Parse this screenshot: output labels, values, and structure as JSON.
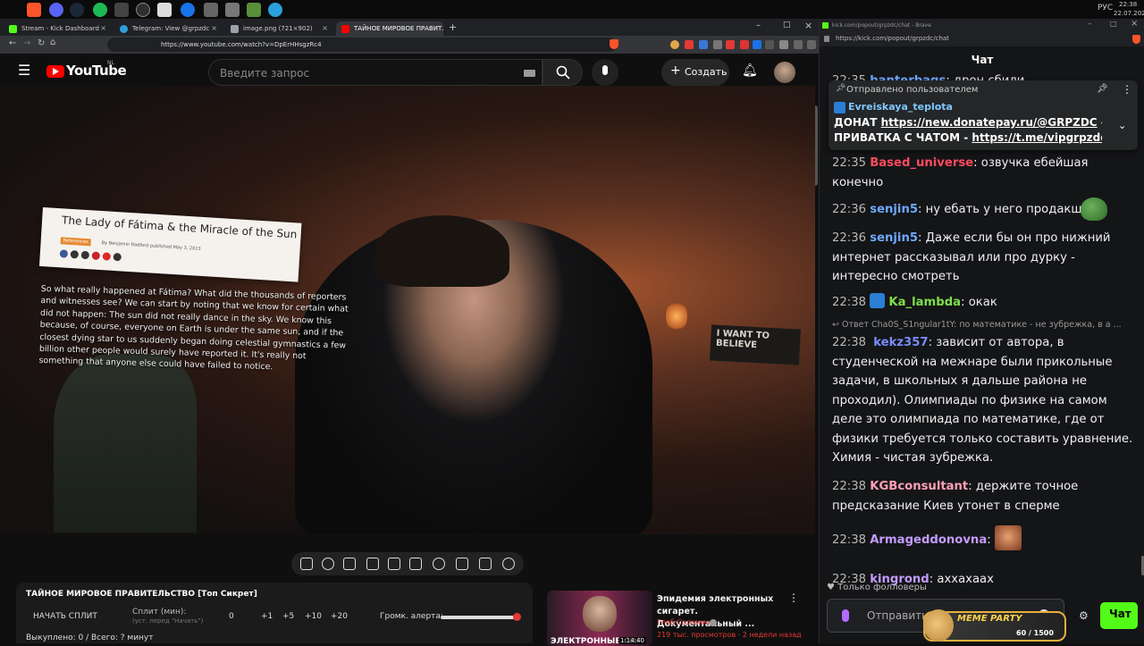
{
  "taskbar": {
    "clock_time": "22:38",
    "clock_date": "22.07.2025",
    "lang": "РУС"
  },
  "left_browser": {
    "tabs": [
      {
        "label": "Stream - Kick Dashboard",
        "color": "#53fc18"
      },
      {
        "label": "Telegram: View @grpzdc",
        "color": "#2aa1da"
      },
      {
        "label": "image.png (721×902)",
        "color": "#9aa0a6"
      },
      {
        "label": "ТАЙНОЕ МИРОВОЕ ПРАВИТ...",
        "color": "#ff0000"
      }
    ],
    "url": "https://www.youtube.com/watch?v=DpErHHsgzRc4"
  },
  "youtube": {
    "logo_text": "YouTube",
    "region": "NL",
    "search_placeholder": "Введите запрос",
    "create_label": "Создать"
  },
  "video_overlay": {
    "article_title": "The Lady of Fátima & the Miracle of the Sun",
    "article_tag": "References",
    "article_byline": "By Benjamin Radford published May 3, 2013",
    "article_body": "So what really happened at Fátima? What did the thousands of reporters and witnesses see? We can start by noting that we know for certain what did not happen: The sun did not really dance in the sky. We know this because, of course, everyone on Earth is under the same sun, and if the closest dying star to us suddenly began doing celestial gymnastics a few billion other people would surely have reported it. It's really not something that anyone else could have failed to notice.",
    "poster_text": "I WANT TO BELIEVE"
  },
  "split_panel": {
    "title": "ТАЙНОЕ МИРОВОЕ ПРАВИТЕЛЬСТВО [Топ Сикрет]",
    "start_label": "НАЧАТЬ СПЛИТ",
    "split_label": "Сплит (мин):",
    "split_hint": "(уст. перед \"Начать\")",
    "split_value": "0",
    "increments": [
      "+1",
      "+5",
      "+10",
      "+20"
    ],
    "alert_label": "Громк. алерта:",
    "alert_volume_fraction": 0.97,
    "status": "Выкуплено: 0 / Всего: ? минут"
  },
  "recommended": {
    "title": "Эпидемия электронных сигарет. Документальный ...",
    "channel": "Глеб Соломин",
    "meta": "219 тыс. просмотров · 2 недели назад",
    "duration": "1:14:40",
    "thumb_text": "ЭЛЕКТРОННЫЕ СИГ"
  },
  "right_browser": {
    "window_title": "kick.com/popout/grpzdc/chat - Brave",
    "url": "https://kick.com/popout/grpzdc/chat"
  },
  "chat": {
    "header": "Чат",
    "partial_top": {
      "ts": "22:35",
      "user": "banterbags",
      "text": "дрон сбили",
      "color": "#6ea8ff"
    },
    "pinned": {
      "label": "Отправлено пользователем",
      "user": "Evreiskaya_teplota",
      "line1_prefix": "ДОНАТ",
      "line1_link": "https://new.donatepay.ru/@GRPZDC",
      "line1_suffix": " -",
      "line2_prefix": "ПРИВАТКА С ЧАТОМ - ",
      "line2_link": "https://t.me/vipgrpzdc_b..."
    },
    "messages": [
      {
        "ts": "22:35",
        "user": "Based_universe",
        "color": "#ff4a5e",
        "text": "озвучка ебейшая конечно"
      },
      {
        "ts": "22:36",
        "user": "senjin5",
        "color": "#6ea8ff",
        "text": "ну ебать у него продакшн"
      },
      {
        "ts": "22:36",
        "user": "senjin5",
        "color": "#6ea8ff",
        "text": "Даже если бы он про нижний интернет рассказывал или про дурку - интересно смотреть"
      },
      {
        "ts": "22:38",
        "user": "Ka_lambda",
        "color": "#7ee04a",
        "text": "окак"
      },
      {
        "ts": "22:38",
        "user": "kekz357",
        "color": "#7a8cff",
        "text": "зависит от автора, в студенческой на межнаре были прикольные задачи, в школьных я дальше района не проходил). Олимпиады по физике на самом деле это олимпиада по математике, где от физики требуется только составить уравнение. Химия - чистая зубрежка."
      },
      {
        "ts": "22:38",
        "user": "KGBconsultant",
        "color": "#ff9fb5",
        "text": "держите точное предсказание Киев утонет в сперме"
      },
      {
        "ts": "22:38",
        "user": "Armageddonovna",
        "color": "#c49bff",
        "text": ""
      },
      {
        "ts": "22:38",
        "user": "kingrond",
        "color": "#c49bff",
        "text": "аххахаах"
      }
    ],
    "reply_preview": "Ответ Cha0S_S1ngular1tY: по математике - не зубрежка, в а ...",
    "followers_only": "Только фолловеры",
    "input_placeholder": "Отправить",
    "send_label": "Чат",
    "meme_party": {
      "label": "MEME PARTY",
      "progress": "60 / 1500"
    }
  }
}
